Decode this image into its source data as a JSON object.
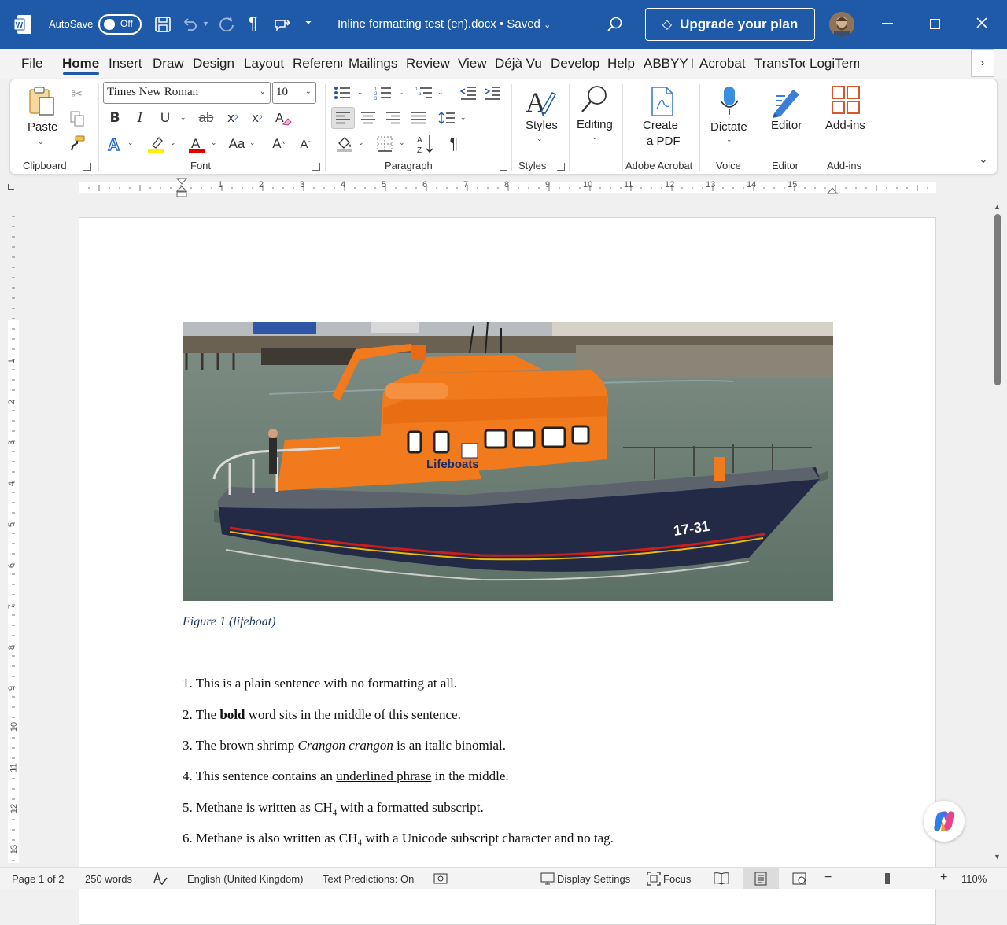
{
  "titlebar": {
    "autosave_label": "AutoSave",
    "autosave_state": "Off",
    "document_title": "Inline formatting test (en).docx",
    "saved_state": "Saved",
    "upgrade_label": "Upgrade your plan"
  },
  "tabs": [
    "File",
    "Home",
    "Insert",
    "Draw",
    "Design",
    "Layout",
    "Referenc",
    "Mailings",
    "Review",
    "View",
    "Déjà Vu",
    "Develop",
    "Help",
    "ABBYY F",
    "Acrobat",
    "TransToo",
    "LogiTerm"
  ],
  "ribbon": {
    "clipboard": {
      "paste_label": "Paste",
      "group_label": "Clipboard"
    },
    "font": {
      "font_name": "Times New Roman",
      "font_size": "10",
      "group_label": "Font"
    },
    "paragraph": {
      "group_label": "Paragraph"
    },
    "styles": {
      "styles_label": "Styles",
      "group_label": "Styles"
    },
    "editing": {
      "label": "Editing"
    },
    "acrobat": {
      "create_line1": "Create",
      "create_line2": "a PDF",
      "group_label": "Adobe Acrobat"
    },
    "voice": {
      "dictate_label": "Dictate",
      "group_label": "Voice"
    },
    "editor": {
      "label": "Editor",
      "group_label": "Editor"
    },
    "addins": {
      "label": "Add-ins",
      "group_label": "Add-ins"
    }
  },
  "ruler": {
    "numbers": [
      "1",
      "2",
      "3",
      "4",
      "5",
      "6",
      "7",
      "8",
      "9",
      "10",
      "11",
      "12",
      "13",
      "14",
      "15"
    ]
  },
  "vruler": {
    "numbers": [
      "1",
      "2",
      "3",
      "4",
      "5",
      "6",
      "7",
      "8",
      "9",
      "10",
      "11",
      "12",
      "13"
    ]
  },
  "document": {
    "boat_label": "Lifeboats",
    "boat_number": "17-31",
    "caption": "Figure 1 (lifeboat)",
    "p1": "1. This is a plain sentence with no formatting at all.",
    "p2_a": "2. The ",
    "p2_b": "bold",
    "p2_c": " word sits in the middle of this sentence.",
    "p3_a": "3. The brown shrimp ",
    "p3_b": "Crangon crangon",
    "p3_c": " is an italic binomial.",
    "p4_a": "4. This sentence contains an ",
    "p4_b": "underlined phrase",
    "p4_c": " in the middle.",
    "p5_a": "5. Methane is written as CH",
    "p5_b": "4",
    "p5_c": " with a formatted subscript.",
    "p6": "6. Methane is also written as CH₄ with a Unicode subscript character and no tag."
  },
  "statusbar": {
    "page": "Page 1 of 2",
    "words": "250 words",
    "language": "English (United Kingdom)",
    "predictions": "Text Predictions: On",
    "display_settings": "Display Settings",
    "focus": "Focus",
    "zoom": "110%"
  },
  "colors": {
    "accent": "#1f5aa8",
    "boat_orange": "#f07a1c",
    "hull_navy": "#232a45",
    "caption": "#1f3864"
  }
}
